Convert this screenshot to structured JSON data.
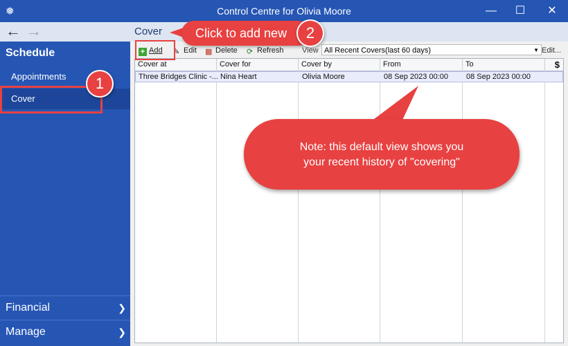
{
  "window": {
    "title": "Control Centre for Olivia Moore",
    "icons": {
      "app": "gear-icon",
      "minimize": "minimize-icon",
      "maximize": "maximize-icon",
      "close": "close-icon"
    }
  },
  "nav": {
    "back_icon": "arrow-left-icon",
    "forward_icon": "arrow-right-icon"
  },
  "sidebar": {
    "section_title": "Schedule",
    "items": [
      {
        "label": "Appointments"
      },
      {
        "label": "Cover",
        "selected": true
      }
    ],
    "groups": [
      {
        "label": "Financial",
        "icon": "chevron-down-icon"
      },
      {
        "label": "Manage",
        "icon": "chevron-down-icon"
      }
    ],
    "colors": {
      "background": "#2656b4",
      "selected": "#1d469a"
    }
  },
  "content": {
    "title": "Cover",
    "toolbar": {
      "add": "Add",
      "edit": "Edit",
      "delete": "Delete",
      "refresh": "Refresh",
      "view_label": "View",
      "view_selected": "All Recent Covers(last 60 days)",
      "edit_view": "Edit..."
    },
    "grid": {
      "columns": [
        "Cover at",
        "Cover for",
        "Cover by",
        "From",
        "To",
        "$"
      ],
      "rows": [
        [
          "Three Bridges Clinic -...",
          "Nina Heart",
          "Olivia Moore",
          "08 Sep 2023 00:00",
          "08 Sep 2023 00:00",
          ""
        ]
      ]
    }
  },
  "annotations": {
    "badge_1": "1",
    "badge_2": "2",
    "callout_add": "Click to add new",
    "callout_note_line1": "Note: this default view shows you",
    "callout_note_line2": "your recent history of \"covering\"",
    "accent_color": "#e84141"
  }
}
